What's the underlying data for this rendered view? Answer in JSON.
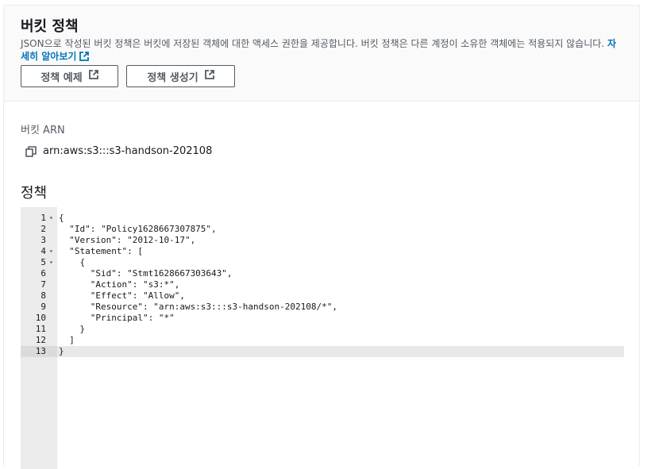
{
  "header": {
    "title": "버킷 정책",
    "description": "JSON으로 작성된 버킷 정책은 버킷에 저장된 객체에 대한 액세스 권한을 제공합니다. 버킷 정책은 다른 계정이 소유한 객체에는 적용되지 않습니다.",
    "learn_more": "자세히 알아보기",
    "buttons": [
      {
        "label": "정책 예제",
        "icon": "external-link-icon"
      },
      {
        "label": "정책 생성기",
        "icon": "external-link-icon"
      }
    ]
  },
  "bucket_arn": {
    "label": "버킷 ARN",
    "value": "arn:aws:s3:::s3-handson-202108",
    "icon": "copy-icon"
  },
  "policy": {
    "label": "정책",
    "active_line": 13,
    "lines": [
      {
        "num": "1",
        "fold": true,
        "text": "{"
      },
      {
        "num": "2",
        "fold": false,
        "text": "  \"Id\": \"Policy1628667307875\","
      },
      {
        "num": "3",
        "fold": false,
        "text": "  \"Version\": \"2012-10-17\","
      },
      {
        "num": "4",
        "fold": true,
        "text": "  \"Statement\": ["
      },
      {
        "num": "5",
        "fold": true,
        "text": "    {"
      },
      {
        "num": "6",
        "fold": false,
        "text": "      \"Sid\": \"Stmt1628667303643\","
      },
      {
        "num": "7",
        "fold": false,
        "text": "      \"Action\": \"s3:*\","
      },
      {
        "num": "8",
        "fold": false,
        "text": "      \"Effect\": \"Allow\","
      },
      {
        "num": "9",
        "fold": false,
        "text": "      \"Resource\": \"arn:aws:s3:::s3-handson-202108/*\","
      },
      {
        "num": "10",
        "fold": false,
        "text": "      \"Principal\": \"*\""
      },
      {
        "num": "11",
        "fold": false,
        "text": "    }"
      },
      {
        "num": "12",
        "fold": false,
        "text": "  ]"
      },
      {
        "num": "13",
        "fold": false,
        "text": "}"
      }
    ]
  }
}
